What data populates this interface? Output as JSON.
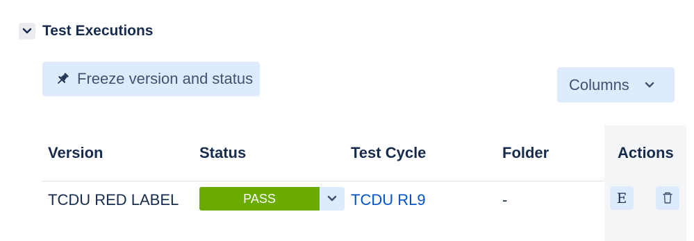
{
  "section": {
    "title": "Test Executions",
    "toggle_icon": "chevron-down-icon"
  },
  "toolbar": {
    "freeze_label": "Freeze version and status",
    "freeze_icon": "pin-icon",
    "columns_label": "Columns",
    "columns_icon": "chevron-down-icon"
  },
  "table": {
    "headers": [
      "Version",
      "Status",
      "Test Cycle",
      "Folder",
      "Actions"
    ],
    "rows": [
      {
        "version": "TCDU RED LABEL",
        "status": "PASS",
        "test_cycle": "TCDU RL9",
        "folder": "-",
        "actions": {
          "execute_label": "E",
          "delete_icon": "trash-icon"
        }
      }
    ]
  },
  "colors": {
    "pass": "#6aab00",
    "button_bg": "#deebff",
    "link": "#0052cc",
    "text": "#172b4d",
    "actions_column_bg": "#f4f5f7"
  }
}
